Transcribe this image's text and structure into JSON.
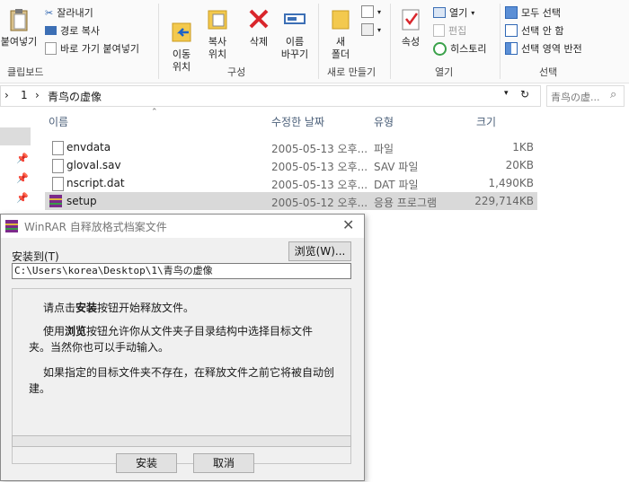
{
  "ribbon": {
    "clipboard": {
      "paste": "붙여넣기",
      "cut": "잘라내기",
      "copy_path": "경로 복사",
      "paste_shortcut": "바로 가기 붙여넣기",
      "group": "클립보드"
    },
    "organize": {
      "move_to": "이동\n위치",
      "copy_to": "복사\n위치",
      "delete": "삭제",
      "rename": "이름\n바꾸기",
      "group": "구성"
    },
    "new": {
      "new_folder": "새\n폴더",
      "group": "새로 만들기"
    },
    "open": {
      "properties": "속성",
      "open": "열기",
      "edit": "편집",
      "history": "히스토리",
      "group": "열기"
    },
    "select": {
      "select_all": "모두 선택",
      "select_none": "선택 안 함",
      "invert": "선택 영역 반전",
      "group": "선택"
    }
  },
  "address": {
    "crumb1": "1",
    "crumb2": "青鸟の虚像",
    "search_placeholder": "青鸟の虚..."
  },
  "columns": {
    "name": "이름",
    "modified": "수정한 날짜",
    "type": "유형",
    "size": "크기"
  },
  "files": [
    {
      "name": "envdata",
      "modified": "2005-05-13 오후...",
      "type": "파일",
      "size": "1KB"
    },
    {
      "name": "gloval.sav",
      "modified": "2005-05-13 오후...",
      "type": "SAV 파일",
      "size": "20KB"
    },
    {
      "name": "nscript.dat",
      "modified": "2005-05-13 오후...",
      "type": "DAT 파일",
      "size": "1,490KB"
    },
    {
      "name": "setup",
      "modified": "2005-05-12 오후...",
      "type": "응용 프로그램",
      "size": "229,714KB"
    }
  ],
  "dialog": {
    "title": "WinRAR 自释放格式档案文件",
    "install_to_label": "安装到(T)",
    "browse": "浏览(W)...",
    "path": "C:\\Users\\korea\\Desktop\\1\\青鸟の虚像",
    "p1_pre": "请点击",
    "p1_bold": "安装",
    "p1_post": "按钮开始释放文件。",
    "p2_pre": "使用",
    "p2_bold": "浏览",
    "p2_post": "按钮允许你从文件夹子目录结构中选择目标文件夹。当然你也可以手动输入。",
    "p3": "如果指定的目标文件夹不存在，在释放文件之前它将被自动创建。",
    "install_btn": "安装",
    "cancel_btn": "取消"
  }
}
